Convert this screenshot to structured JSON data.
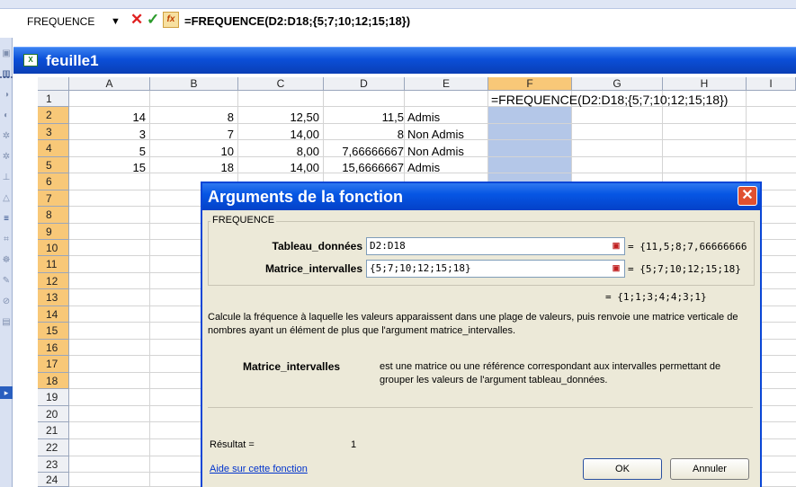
{
  "formula_bar": {
    "name_box": "FREQUENCE",
    "formula": "=FREQUENCE(D2:D18;{5;7;10;12;15;18})",
    "fx_label": "fx"
  },
  "window": {
    "title": "feuille1"
  },
  "columns": [
    "A",
    "B",
    "C",
    "D",
    "E",
    "F",
    "G",
    "H",
    "I"
  ],
  "rows": [
    "1",
    "2",
    "3",
    "4",
    "5",
    "6",
    "7",
    "8",
    "9",
    "10",
    "11",
    "12",
    "13",
    "14",
    "15",
    "16",
    "17",
    "18",
    "19",
    "20",
    "21",
    "22",
    "23",
    "24"
  ],
  "cells": {
    "F1": "=FREQUENCE(D2:D18;{5;7;10;12;15;18})",
    "A2": "14",
    "B2": "8",
    "C2": "12,50",
    "D2": "11,5",
    "E2": "Admis",
    "A3": "3",
    "B3": "7",
    "C3": "14,00",
    "D3": "8",
    "E3": "Non Admis",
    "A4": "5",
    "B4": "10",
    "C4": "8,00",
    "D4": "7,66666667",
    "E4": "Non Admis",
    "A5": "15",
    "B5": "18",
    "C5": "14,00",
    "D5": "15,6666667",
    "E5": "Admis"
  },
  "dialog": {
    "title": "Arguments de la fonction",
    "function_name": "FREQUENCE",
    "arg1_label": "Tableau_données",
    "arg1_value": "D2:D18",
    "arg1_preview": "= {11,5;8;7,66666666",
    "arg2_label": "Matrice_intervalles",
    "arg2_value": "{5;7;10;12;15;18}",
    "arg2_preview": "= {5;7;10;12;15;18}",
    "result_preview": "= {1;1;3;4;4;3;1}",
    "description": "Calcule la fréquence à laquelle les valeurs apparaissent dans une plage de valeurs, puis renvoie une matrice verticale de nombres ayant un élément de plus que l'argument matrice_intervalles.",
    "help_arg_name": "Matrice_intervalles",
    "help_arg_text": "est une matrice ou une référence correspondant aux intervalles permettant de grouper les valeurs de l'argument tableau_données.",
    "result_label": "Résultat =",
    "result_value": "1",
    "help_link": "Aide sur cette fonction",
    "ok_label": "OK",
    "cancel_label": "Annuler"
  }
}
